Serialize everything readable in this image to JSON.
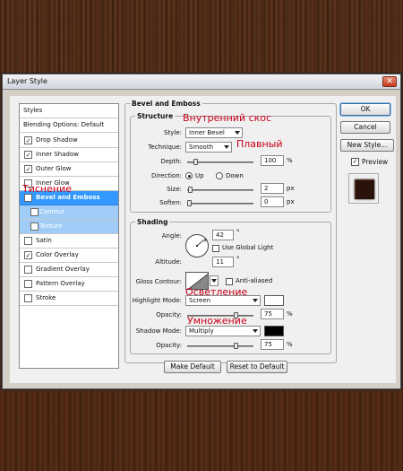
{
  "window": {
    "title": "Layer Style",
    "close_glyph": "✕"
  },
  "styles_panel": {
    "header": "Styles",
    "items": [
      {
        "label": "Blending Options: Default",
        "checkbox": false,
        "checked": false,
        "state": "normal"
      },
      {
        "label": "Drop Shadow",
        "checkbox": true,
        "checked": true,
        "state": "normal"
      },
      {
        "label": "Inner Shadow",
        "checkbox": true,
        "checked": true,
        "state": "normal"
      },
      {
        "label": "Outer Glow",
        "checkbox": true,
        "checked": true,
        "state": "normal"
      },
      {
        "label": "Inner Glow",
        "checkbox": true,
        "checked": false,
        "state": "normal"
      },
      {
        "label": "Bevel and Emboss",
        "checkbox": true,
        "checked": true,
        "state": "selected"
      },
      {
        "label": "Contour",
        "checkbox": true,
        "checked": false,
        "state": "sub"
      },
      {
        "label": "Texture",
        "checkbox": true,
        "checked": false,
        "state": "sub"
      },
      {
        "label": "Satin",
        "checkbox": true,
        "checked": false,
        "state": "normal"
      },
      {
        "label": "Color Overlay",
        "checkbox": true,
        "checked": true,
        "state": "normal"
      },
      {
        "label": "Gradient Overlay",
        "checkbox": true,
        "checked": false,
        "state": "normal"
      },
      {
        "label": "Pattern Overlay",
        "checkbox": true,
        "checked": false,
        "state": "normal"
      },
      {
        "label": "Stroke",
        "checkbox": true,
        "checked": false,
        "state": "normal"
      }
    ]
  },
  "bevel": {
    "group_title": "Bevel and Emboss",
    "structure_title": "Structure",
    "style_label": "Style:",
    "style_value": "Inner Bevel",
    "technique_label": "Technique:",
    "technique_value": "Smooth",
    "depth_label": "Depth:",
    "depth_value": "100",
    "depth_unit": "%",
    "depth_level": 0.1,
    "direction_label": "Direction:",
    "up_label": "Up",
    "down_label": "Down",
    "direction_selected": "Up",
    "size_label": "Size:",
    "size_value": "2",
    "size_unit": "px",
    "size_level": 0.02,
    "soften_label": "Soften:",
    "soften_value": "0",
    "soften_unit": "px",
    "soften_level": 0.0
  },
  "shading": {
    "title": "Shading",
    "angle_label": "Angle:",
    "angle_value": "42",
    "angle_unit": "°",
    "use_global_light_label": "Use Global Light",
    "use_global_light": false,
    "altitude_label": "Altitude:",
    "altitude_value": "11",
    "altitude_unit": "°",
    "gloss_contour_label": "Gloss Contour:",
    "anti_aliased_label": "Anti-aliased",
    "anti_aliased": false,
    "highlight_mode_label": "Highlight Mode:",
    "highlight_mode_value": "Screen",
    "highlight_color": "#ffffff",
    "highlight_opacity_label": "Opacity:",
    "highlight_opacity_value": "75",
    "highlight_opacity_unit": "%",
    "highlight_opacity_level": 0.75,
    "shadow_mode_label": "Shadow Mode:",
    "shadow_mode_value": "Multiply",
    "shadow_color": "#000000",
    "shadow_opacity_label": "Opacity:",
    "shadow_opacity_value": "75",
    "shadow_opacity_unit": "%",
    "shadow_opacity_level": 0.75
  },
  "footer": {
    "make_default": "Make Default",
    "reset_default": "Reset to Default"
  },
  "right_panel": {
    "ok": "OK",
    "cancel": "Cancel",
    "new_style": "New Style...",
    "preview_label": "Preview",
    "preview_checked": true
  },
  "annotations": {
    "inner_bevel": "Внутренний скос",
    "smooth": "Плавный",
    "emboss": "Тиснение",
    "lighten": "Осветление",
    "multiply": "Умножение"
  },
  "colors": {
    "selection": "#3399ff",
    "sub_selection": "#9fcdf8",
    "annotation": "#c8001a"
  }
}
